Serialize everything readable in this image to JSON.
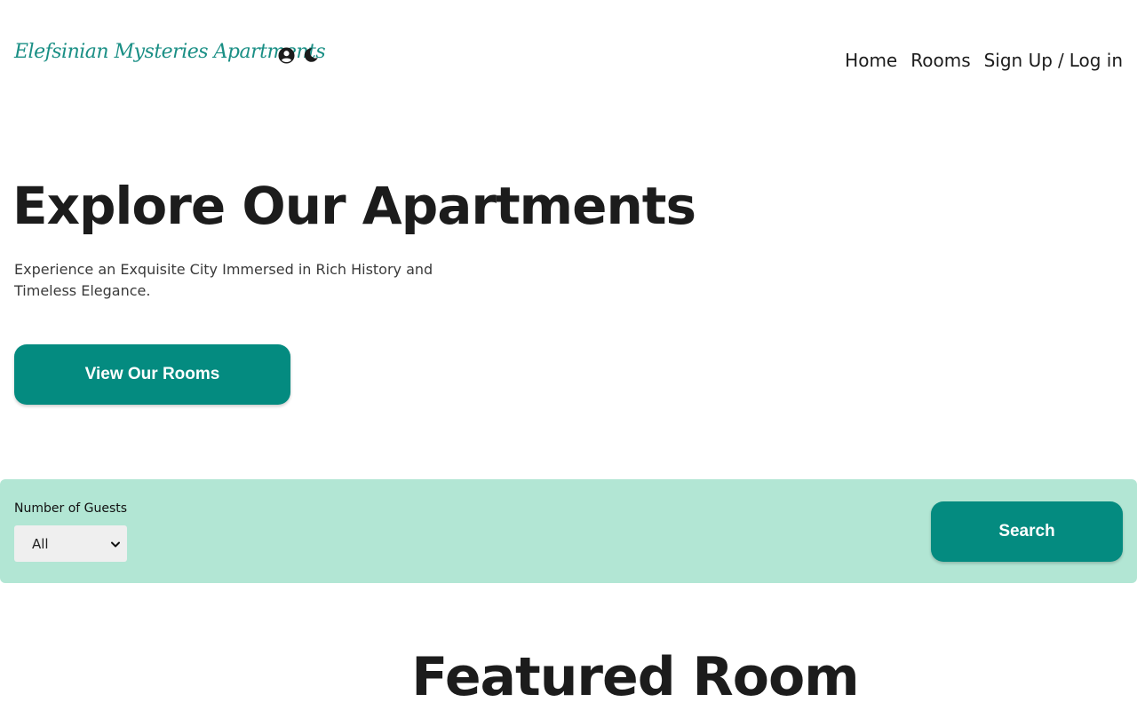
{
  "header": {
    "logo_text": "Elefsinian Mysteries Apartments",
    "icons": [
      "user-circle-icon",
      "moon-icon"
    ],
    "nav": {
      "home": "Home",
      "rooms": "Rooms",
      "signup": "Sign Up",
      "separator": "/",
      "login": "Log in"
    }
  },
  "hero": {
    "title": "Explore Our Apartments",
    "subtitle": "Experience an Exquisite City Immersed in Rich History and Timeless Elegance.",
    "cta_label": "View Our Rooms"
  },
  "filter": {
    "guests_label": "Number of Guests",
    "guests_selected": "All",
    "search_label": "Search"
  },
  "featured": {
    "title": "Featured Room"
  },
  "colors": {
    "accent": "#048b80",
    "logo": "#1a8f85",
    "filter_bg": "#b2e6d4"
  }
}
